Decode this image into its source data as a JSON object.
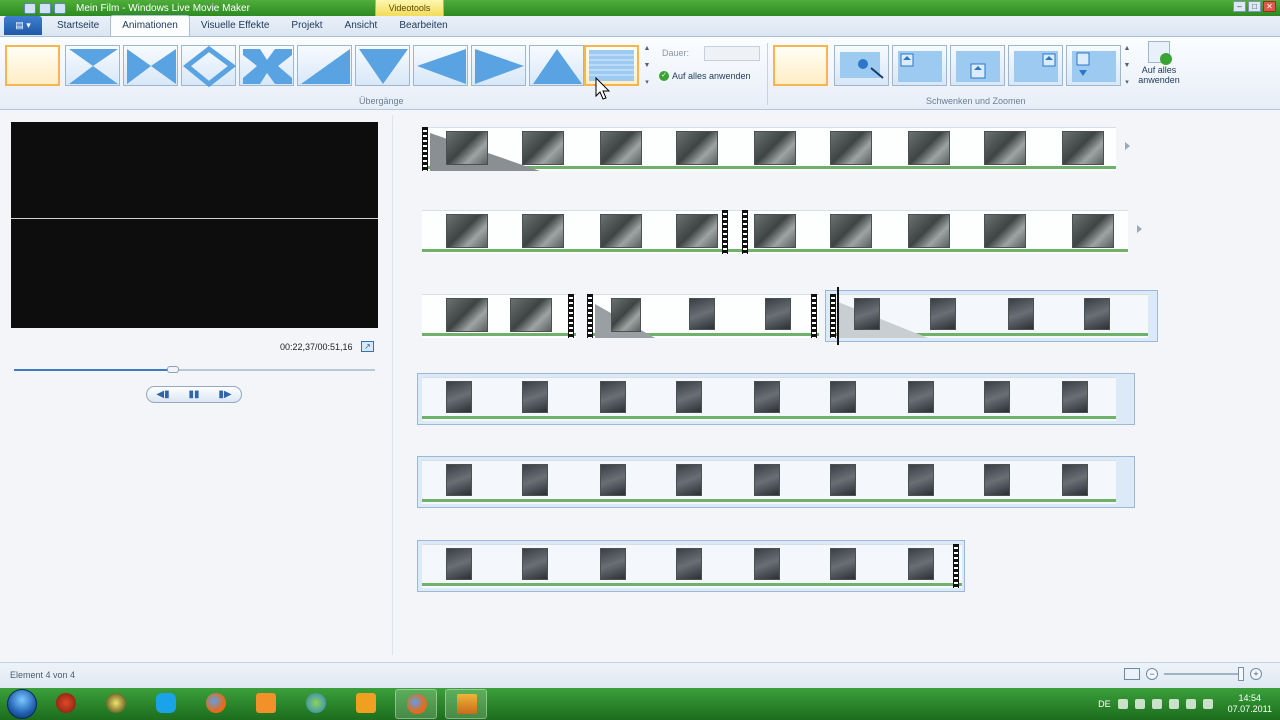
{
  "window": {
    "title": "Mein Film - Windows Live Movie Maker",
    "contextual_tab": "Videotools",
    "buttons": [
      "–",
      "□",
      "✕"
    ]
  },
  "ribbon_tabs": {
    "app_menu": "▤ ▾",
    "items": [
      "Startseite",
      "Animationen",
      "Visuelle Effekte",
      "Projekt",
      "Ansicht",
      "Bearbeiten"
    ],
    "active": "Animationen"
  },
  "transitions_group": {
    "label": "Übergänge",
    "duration_label": "Dauer:",
    "duration_value": "",
    "apply_all": "Auf alles anwenden"
  },
  "panzoom_group": {
    "label": "Schwenken und Zoomen",
    "apply_all_line1": "Auf alles",
    "apply_all_line2": "anwenden"
  },
  "preview": {
    "timecode": "00:22,37/00:51,16",
    "seek_progress": 0.44,
    "controls": {
      "prev": "◀▮",
      "pause": "▮▮",
      "next": "▮▶"
    }
  },
  "status": {
    "text": "Element 4 von 4",
    "zoom_minus": "−",
    "zoom_plus": "+",
    "zoom_level": 0.96
  },
  "taskbar": {
    "lang": "DE",
    "time": "14:54",
    "date": "07.07.2011",
    "apps": [
      "red-circle-app",
      "winamp",
      "skype",
      "firefox",
      "mail",
      "messenger",
      "media-player",
      "firefox-2",
      "movie-maker"
    ]
  },
  "colors": {
    "accent": "#3e7bc4",
    "selection": "#f5b650",
    "taskbar": "#2d8a23"
  }
}
